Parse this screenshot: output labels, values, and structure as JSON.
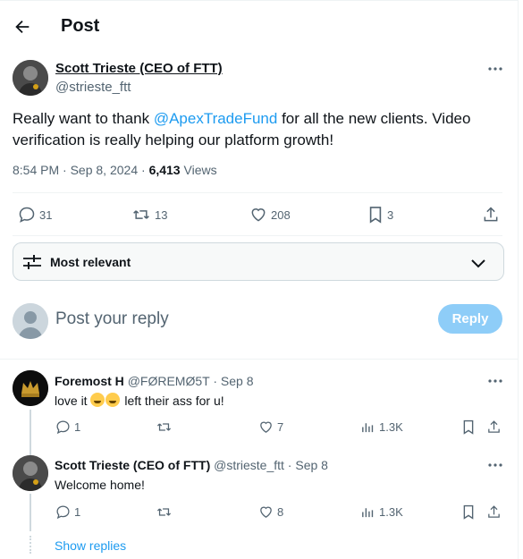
{
  "header": {
    "title": "Post"
  },
  "post": {
    "author_name": "Scott Trieste (CEO of FTT)",
    "author_handle": "@strieste_ftt",
    "text_before": "Really want to thank ",
    "mention": "@ApexTradeFund",
    "text_after": " for all the new clients.  Video verification is really helping our platform growth!",
    "time": "8:54 PM",
    "date": "Sep 8, 2024",
    "views_count": "6,413",
    "views_label": "Views",
    "replies": "31",
    "reposts": "13",
    "likes": "208",
    "bookmarks": "3"
  },
  "sort": {
    "label": "Most relevant"
  },
  "composer": {
    "placeholder": "Post your reply",
    "button": "Reply"
  },
  "replies": [
    {
      "name": "Foremost H",
      "handle": "@FØREMØ5T",
      "date": "Sep 8",
      "text_before": "love it ",
      "emoji_names": [
        "rofl-emoji",
        "rofl-emoji"
      ],
      "text_after": " left their ass for u!",
      "replies": "1",
      "reposts": "",
      "likes": "7",
      "views": "1.3K"
    },
    {
      "name": "Scott Trieste (CEO of FTT)",
      "handle": "@strieste_ftt",
      "date": "Sep 8",
      "text": "Welcome home!",
      "replies": "1",
      "reposts": "",
      "likes": "8",
      "views": "1.3K"
    }
  ],
  "show_replies": "Show replies",
  "colors": {
    "accent": "#1d9bf0",
    "muted": "#536471",
    "reply_button": "#8ecdf8"
  }
}
